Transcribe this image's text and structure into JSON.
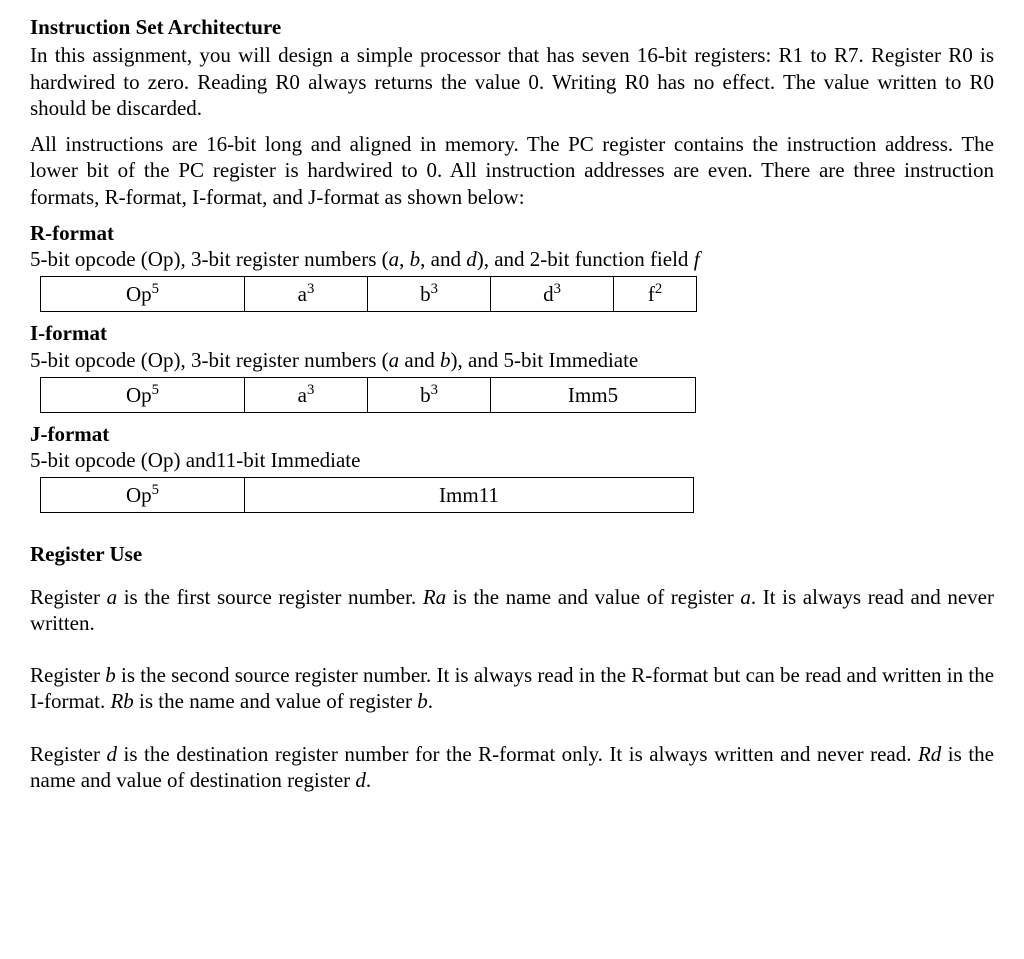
{
  "title": "Instruction Set Architecture",
  "intro_p1": "In this assignment, you will design a simple processor that has seven 16-bit registers: R1 to R7. Register R0 is hardwired to zero. Reading R0 always returns the value 0. Writing R0 has no effect. The value written to R0 should be discarded.",
  "intro_p2": "All instructions are 16-bit long and aligned in memory. The PC register contains the instruction address. The lower bit of the PC register is hardwired to 0. All instruction addresses are even. There are three instruction formats, R-format, I-format, and J-format as shown below:",
  "r": {
    "heading": "R-format",
    "desc_a": "5-bit opcode (Op), 3-bit register numbers (",
    "desc_b": "a",
    "desc_c": ", ",
    "desc_d": "b",
    "desc_e": ", and ",
    "desc_f": "d",
    "desc_g": "), and 2-bit function field ",
    "desc_h": "f",
    "cells": {
      "op": "Op",
      "op_e": "5",
      "a": "a",
      "a_e": "3",
      "b": "b",
      "b_e": "3",
      "d": "d",
      "d_e": "3",
      "f": "f",
      "f_e": "2"
    }
  },
  "i": {
    "heading": "I-format",
    "desc_a": "5-bit opcode (Op), 3-bit register numbers (",
    "desc_b": "a",
    "desc_c": " and ",
    "desc_d": "b",
    "desc_e": "), and 5-bit Immediate",
    "cells": {
      "op": "Op",
      "op_e": "5",
      "a": "a",
      "a_e": "3",
      "b": "b",
      "b_e": "3",
      "imm": "Imm5"
    }
  },
  "j": {
    "heading": "J-format",
    "desc": "5-bit opcode (Op) and11-bit Immediate",
    "cells": {
      "op": "Op",
      "op_e": "5",
      "imm": "Imm11"
    }
  },
  "reguse": {
    "heading": "Register Use",
    "p1_a": "Register ",
    "p1_b": "a",
    "p1_c": " is the first source register number. ",
    "p1_d": "Ra",
    "p1_e": " is the name and value of register ",
    "p1_f": "a",
    "p1_g": ". It is always read and never written.",
    "p2_a": "Register ",
    "p2_b": "b",
    "p2_c": " is the second source register number. It is always read in the R-format but can be read and written in the I-format. ",
    "p2_d": "Rb",
    "p2_e": " is the name and value of register ",
    "p2_f": "b",
    "p2_g": ".",
    "p3_a": "Register ",
    "p3_b": "d",
    "p3_c": " is the destination register number for the R-format only. It is always written and never read. ",
    "p3_d": "Rd",
    "p3_e": " is the name and value of destination register ",
    "p3_f": "d",
    "p3_g": "."
  }
}
